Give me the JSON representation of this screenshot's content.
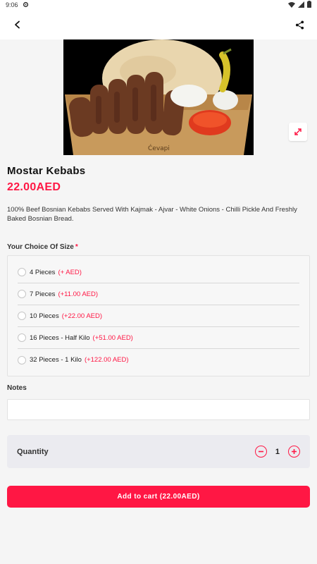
{
  "status_bar": {
    "time": "9:06",
    "icons": [
      "gear-icon",
      "wifi-icon",
      "cell-signal-icon",
      "battery-icon"
    ]
  },
  "app_bar": {
    "back_icon": "chevron-left-icon",
    "share_icon": "share-icon"
  },
  "product": {
    "image_icon": "food-photo",
    "title": "Mostar Kebabs",
    "price": "22.00AED",
    "description": "100% Beef Bosnian Kebabs Served With Kajmak - Ajvar - White Onions - Chilli Pickle And Freshly Baked Bosnian Bread."
  },
  "size_section": {
    "label": "Your Choice Of Size",
    "required_mark": "*",
    "options": [
      {
        "label": "4 Pieces",
        "extra": "(+ AED)"
      },
      {
        "label": "7 Pieces",
        "extra": "(+11.00 AED)"
      },
      {
        "label": "10 Pieces",
        "extra": "(+22.00 AED)"
      },
      {
        "label": "16 Pieces - Half Kilo",
        "extra": "(+51.00 AED)"
      },
      {
        "label": "32 Pieces - 1 Kilo",
        "extra": "(+122.00 AED)"
      }
    ]
  },
  "notes": {
    "label": "Notes",
    "value": "",
    "placeholder": ""
  },
  "quantity": {
    "label": "Quantity",
    "value": "1"
  },
  "cart_button": {
    "label": "Add to cart (22.00AED)"
  },
  "colors": {
    "accent": "#ff1744",
    "background": "#f5f5f5"
  }
}
